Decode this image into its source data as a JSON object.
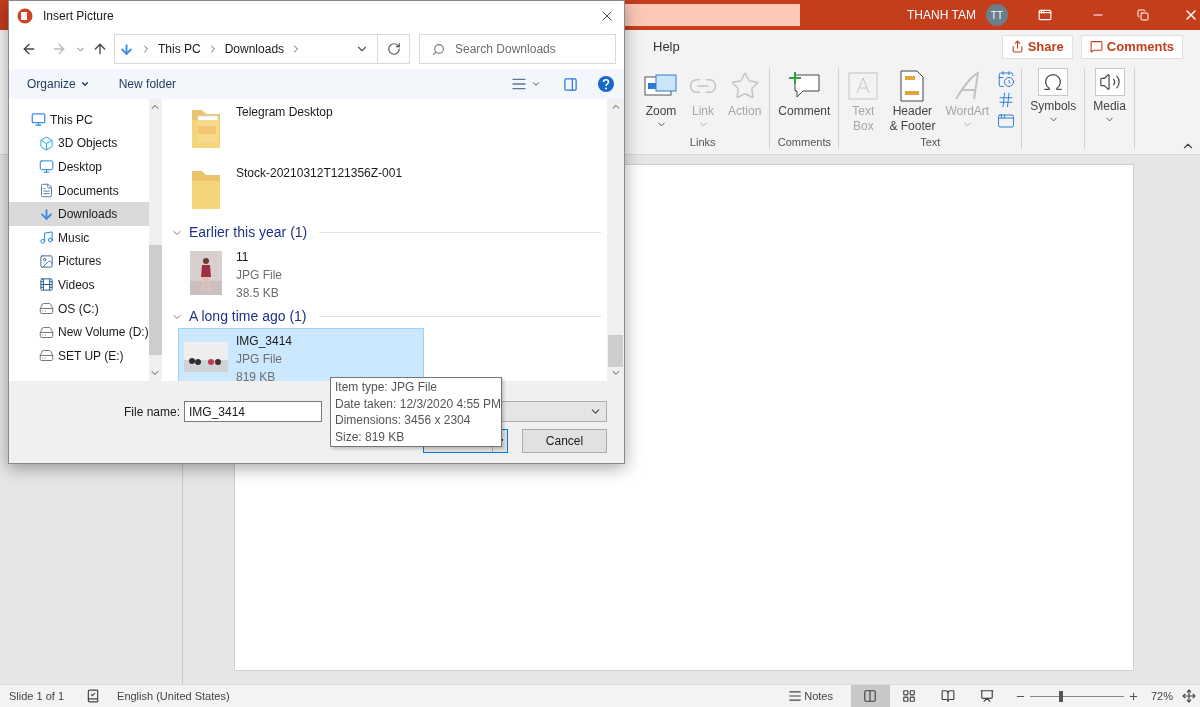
{
  "app": {
    "user_name": "THANH TAM",
    "avatar_initials": "TT"
  },
  "ribbon": {
    "tab": "Help",
    "share": "Share",
    "comments": "Comments",
    "groups": [
      {
        "label": "Links",
        "buttons": [
          {
            "kind": "large",
            "lines": [
              "Zoom"
            ],
            "disabled": false,
            "dropdown": true
          },
          {
            "kind": "large",
            "lines": [
              "Link"
            ],
            "disabled": true,
            "dropdown": true
          },
          {
            "kind": "large",
            "lines": [
              "Action"
            ],
            "disabled": true,
            "dropdown": false
          }
        ]
      },
      {
        "label": "Comments",
        "buttons": [
          {
            "kind": "large",
            "lines": [
              "Comment"
            ],
            "disabled": false,
            "dropdown": false
          }
        ]
      },
      {
        "label": "Text",
        "buttons": [
          {
            "kind": "large",
            "lines": [
              "Text",
              "Box"
            ],
            "disabled": true,
            "dropdown": false
          },
          {
            "kind": "large",
            "lines": [
              "Header",
              "& Footer"
            ],
            "disabled": false,
            "dropdown": false
          },
          {
            "kind": "large",
            "lines": [
              "WordArt"
            ],
            "disabled": true,
            "dropdown": true
          },
          {
            "kind": "stack"
          }
        ]
      },
      {
        "buttons": [
          {
            "kind": "boxed",
            "lines": [
              "Symbols"
            ],
            "disabled": false,
            "dropdown": true
          }
        ]
      },
      {
        "buttons": [
          {
            "kind": "boxed",
            "lines": [
              "Media"
            ],
            "disabled": false,
            "dropdown": true
          }
        ]
      }
    ]
  },
  "dialog": {
    "title": "Insert Picture",
    "breadcrumb": [
      "This PC",
      "Downloads"
    ],
    "search_placeholder": "Search Downloads",
    "organize": "Organize",
    "new_folder": "New folder",
    "nav": [
      {
        "label": "This PC",
        "selected": false,
        "children": [
          {
            "label": "3D Objects",
            "selected": false
          },
          {
            "label": "Desktop",
            "selected": false
          },
          {
            "label": "Documents",
            "selected": false
          },
          {
            "label": "Downloads",
            "selected": true
          },
          {
            "label": "Music",
            "selected": false
          },
          {
            "label": "Pictures",
            "selected": false
          },
          {
            "label": "Videos",
            "selected": false
          },
          {
            "label": "OS (C:)",
            "selected": false
          },
          {
            "label": "New Volume (D:)",
            "selected": false
          },
          {
            "label": "SET UP (E:)",
            "selected": false
          }
        ]
      }
    ],
    "groups": [
      {
        "items": [
          {
            "kind": "folder_pdf",
            "name": "Telegram Desktop",
            "selected": false
          },
          {
            "kind": "folder",
            "name": "Stock-20210312T121356Z-001",
            "selected": false
          }
        ]
      },
      {
        "title": "Earlier this year (1)",
        "expanded": true,
        "items": [
          {
            "kind": "portrait",
            "name": "11",
            "type": "JPG File",
            "size": "38.5 KB",
            "selected": false
          }
        ]
      },
      {
        "title": "A long time ago (1)",
        "expanded": true,
        "items": [
          {
            "kind": "landscape",
            "name": "IMG_3414",
            "type": "JPG File",
            "size": "819 KB",
            "selected": true
          }
        ]
      }
    ],
    "file_name_label": "File name:",
    "file_name": "IMG_3414",
    "cancel": "Cancel",
    "tooltip": [
      "Item type: JPG File",
      "Date taken: 12/3/2020 4:55 PM",
      "Dimensions: 3456 x 2304",
      "Size: 819 KB"
    ]
  },
  "status_bar": {
    "slide": "Slide 1 of 1",
    "language": "English (United States)",
    "notes": "Notes",
    "views": [
      {
        "selected": true
      },
      {
        "selected": false
      },
      {
        "selected": false
      },
      {
        "selected": false
      }
    ],
    "zoom": {
      "level": 0.33,
      "reading": "72%"
    }
  }
}
